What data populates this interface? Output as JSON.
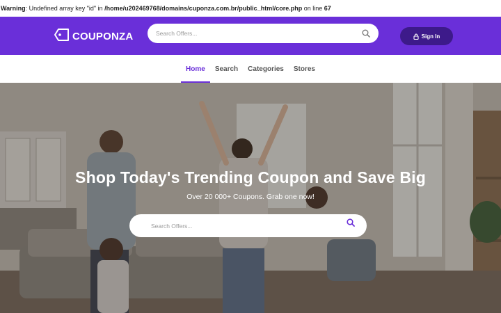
{
  "warning": {
    "label": "Warning",
    "text": ": Undefined array key \"id\" in ",
    "path": "/home/u202469768/domains/cuponza.com.br/public_html/core.php",
    "line_label": " on line ",
    "line": "67"
  },
  "header": {
    "logo_text": "COUPONZA",
    "search_placeholder": "Search Offers...",
    "signin_label": "Sign In",
    "colors": {
      "primary": "#6a2fd9",
      "signin_bg": "#3d1a8a"
    }
  },
  "nav": {
    "items": [
      {
        "label": "Home",
        "active": true
      },
      {
        "label": "Search",
        "active": false
      },
      {
        "label": "Categories",
        "active": false
      },
      {
        "label": "Stores",
        "active": false
      }
    ]
  },
  "hero": {
    "title": "Shop Today's Trending Coupon and Save Big",
    "subtitle": "Over 20 000+ Coupons. Grab one now!",
    "search_placeholder": "Search Offers...",
    "search_icon": "search-icon"
  }
}
